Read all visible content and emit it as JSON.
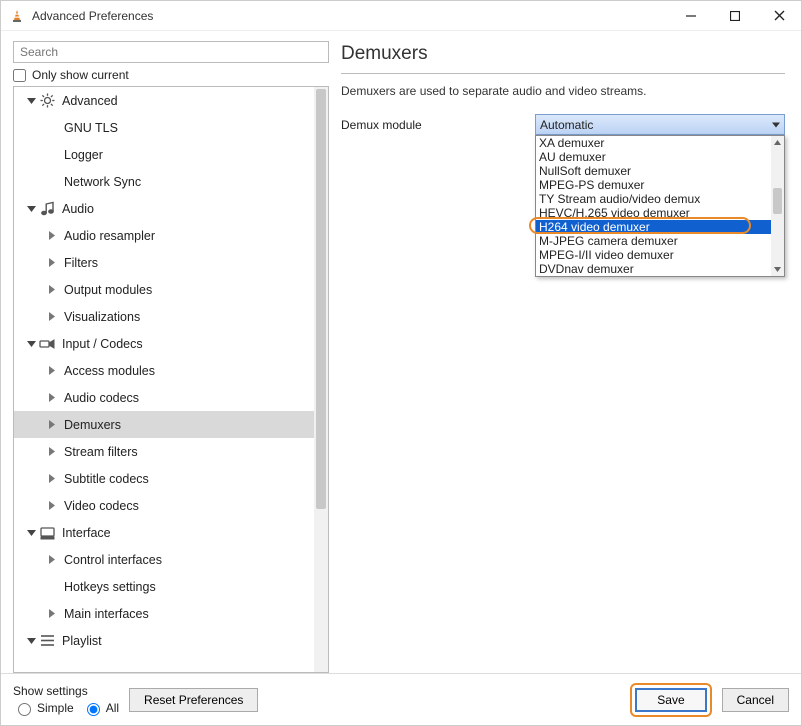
{
  "window": {
    "title": "Advanced Preferences"
  },
  "search": {
    "placeholder": "Search"
  },
  "only_show_current": {
    "label": "Only show current"
  },
  "tree": {
    "items": [
      {
        "label": "Advanced",
        "depth": 0,
        "caret": "down",
        "icon": "gear",
        "selected": false
      },
      {
        "label": "GNU TLS",
        "depth": 1,
        "caret": "none",
        "icon": "",
        "selected": false
      },
      {
        "label": "Logger",
        "depth": 1,
        "caret": "none",
        "icon": "",
        "selected": false
      },
      {
        "label": "Network Sync",
        "depth": 1,
        "caret": "none",
        "icon": "",
        "selected": false
      },
      {
        "label": "Audio",
        "depth": 0,
        "caret": "down",
        "icon": "note",
        "selected": false
      },
      {
        "label": "Audio resampler",
        "depth": 1,
        "caret": "right",
        "icon": "",
        "selected": false
      },
      {
        "label": "Filters",
        "depth": 1,
        "caret": "right",
        "icon": "",
        "selected": false
      },
      {
        "label": "Output modules",
        "depth": 1,
        "caret": "right",
        "icon": "",
        "selected": false
      },
      {
        "label": "Visualizations",
        "depth": 1,
        "caret": "right",
        "icon": "",
        "selected": false
      },
      {
        "label": "Input / Codecs",
        "depth": 0,
        "caret": "down",
        "icon": "codec",
        "selected": false
      },
      {
        "label": "Access modules",
        "depth": 1,
        "caret": "right",
        "icon": "",
        "selected": false
      },
      {
        "label": "Audio codecs",
        "depth": 1,
        "caret": "right",
        "icon": "",
        "selected": false
      },
      {
        "label": "Demuxers",
        "depth": 1,
        "caret": "right",
        "icon": "",
        "selected": true
      },
      {
        "label": "Stream filters",
        "depth": 1,
        "caret": "right",
        "icon": "",
        "selected": false
      },
      {
        "label": "Subtitle codecs",
        "depth": 1,
        "caret": "right",
        "icon": "",
        "selected": false
      },
      {
        "label": "Video codecs",
        "depth": 1,
        "caret": "right",
        "icon": "",
        "selected": false
      },
      {
        "label": "Interface",
        "depth": 0,
        "caret": "down",
        "icon": "interface",
        "selected": false
      },
      {
        "label": "Control interfaces",
        "depth": 1,
        "caret": "right",
        "icon": "",
        "selected": false
      },
      {
        "label": "Hotkeys settings",
        "depth": 1,
        "caret": "none",
        "icon": "",
        "selected": false
      },
      {
        "label": "Main interfaces",
        "depth": 1,
        "caret": "right",
        "icon": "",
        "selected": false
      },
      {
        "label": "Playlist",
        "depth": 0,
        "caret": "down",
        "icon": "playlist",
        "selected": false
      }
    ]
  },
  "right": {
    "heading": "Demuxers",
    "description": "Demuxers are used to separate audio and video streams.",
    "field_label": "Demux module",
    "selected": "Automatic",
    "options": [
      "XA demuxer",
      "AU demuxer",
      "NullSoft demuxer",
      "MPEG-PS demuxer",
      "TY Stream audio/video demux",
      "HEVC/H.265 video demuxer",
      "H264 video demuxer",
      "M-JPEG camera demuxer",
      "MPEG-I/II video demuxer",
      "DVDnav demuxer"
    ],
    "highlight_index": 6
  },
  "bottom": {
    "show_label": "Show settings",
    "simple": "Simple",
    "all": "All",
    "reset": "Reset Preferences",
    "save": "Save",
    "cancel": "Cancel"
  }
}
